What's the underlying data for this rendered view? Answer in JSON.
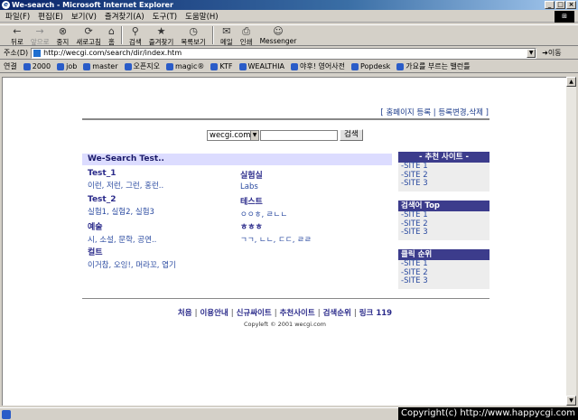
{
  "window": {
    "title": "We-search - Microsoft Internet Explorer",
    "controls": [
      "_",
      "□",
      "×"
    ]
  },
  "menu": [
    "파일(F)",
    "편집(E)",
    "보기(V)",
    "즐겨찾기(A)",
    "도구(T)",
    "도움말(H)"
  ],
  "toolbar": [
    {
      "label": "뒤로",
      "icon": "←",
      "disabled": false
    },
    {
      "label": "앞으로",
      "icon": "→",
      "disabled": true
    },
    {
      "label": "중지",
      "icon": "⊗",
      "disabled": false
    },
    {
      "label": "새로고침",
      "icon": "⟳",
      "disabled": false
    },
    {
      "label": "홈",
      "icon": "⌂",
      "disabled": false
    },
    {
      "label": "검색",
      "icon": "⚲",
      "disabled": false
    },
    {
      "label": "즐겨찾기",
      "icon": "★",
      "disabled": false
    },
    {
      "label": "목록보기",
      "icon": "◷",
      "disabled": false
    },
    {
      "label": "메일",
      "icon": "✉",
      "disabled": false
    },
    {
      "label": "인쇄",
      "icon": "⎙",
      "disabled": false
    },
    {
      "label": "Messenger",
      "icon": "☺",
      "disabled": false
    }
  ],
  "address": {
    "label": "주소(D)",
    "url": "http://wecgi.com/search/dir/index.htm",
    "go": "이동"
  },
  "links": {
    "label": "연결",
    "items": [
      "2000",
      "job",
      "master",
      "오픈지오",
      "magic®",
      "KTF",
      "WEALTHIA",
      "야후! 영어사전",
      "Popdesk",
      "가요를 부르는 밸런틀"
    ]
  },
  "page": {
    "top_links": {
      "home": "홈페이지 등록",
      "edit": "등록변경,삭제"
    },
    "search": {
      "select_value": "wecgi.com",
      "button": "검색"
    },
    "main_title": "We-Search Test..",
    "categories": [
      {
        "title": "Test_1",
        "subs": "이런, 저런, 그런, 홍런.."
      },
      {
        "title": "Test_2",
        "subs": "실험1, 실험2, 실험3"
      },
      {
        "title": "예술",
        "subs": "시, 소설, 문학, 공연.."
      },
      {
        "title": "컬트",
        "subs": "이거참, 오잉!, 머라꼬, 엽기"
      },
      {
        "title": "실험실",
        "subs": "Labs"
      },
      {
        "title": "테스트",
        "subs": "ㅇㅇㅎ, ㄹㄴㄴ"
      },
      {
        "title": "ㅎㅎㅎ",
        "subs": "ㄱㄱ, ㄴㄴ, ㄷㄷ, ㄹㄹ"
      }
    ],
    "side_boxes": [
      {
        "title": "- 추천 사이트 -",
        "items": [
          "-SITE 1",
          "-SITE 2",
          "-SITE 3"
        ]
      },
      {
        "title": "검색어 Top",
        "items": [
          "-SITE 1",
          "-SITE 2",
          "-SITE 3"
        ]
      },
      {
        "title": "클릭 순위",
        "items": [
          "-SITE 1",
          "-SITE 2",
          "-SITE 3"
        ]
      }
    ],
    "footer_nav": [
      "처음",
      "이용안내",
      "신규싸이트",
      "추천사이트",
      "검색순위",
      "링크 119"
    ],
    "copyright": "Copyleft © 2001 wecgi.com"
  },
  "watermark": "Copyright(c) http://www.happycgi.com"
}
